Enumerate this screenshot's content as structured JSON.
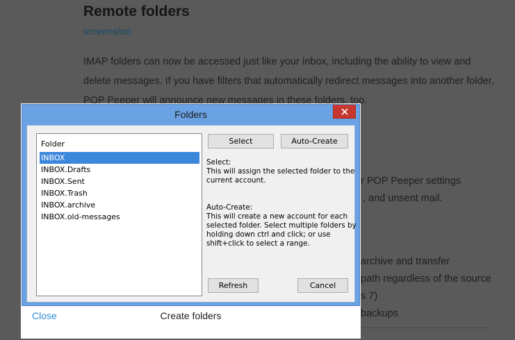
{
  "article": {
    "title": "Remote folders",
    "link": "screenshot",
    "paragraph": "IMAP folders can now be accessed just like your inbox, including the ability to view and delete messages. If you have filters that automatically redirect messages into another folder, POP Peeper will announce new messages in these folders, too.",
    "fragments": [
      "r POP Peeper settings",
      ", and unsent mail.",
      "archive and transfer",
      "path regardless of the source",
      "s 7)",
      "backups"
    ]
  },
  "dialog": {
    "title": "Folders",
    "list_header": "Folder",
    "folders": [
      "INBOX",
      "INBOX.Drafts",
      "INBOX.Sent",
      "INBOX.Trash",
      "INBOX.archive",
      "INBOX.old-messages"
    ],
    "selected_index": 0,
    "buttons": {
      "select": "Select",
      "auto_create": "Auto-Create",
      "refresh": "Refresh",
      "cancel": "Cancel"
    },
    "select_info": {
      "heading": "Select:",
      "lines": [
        "This will assign the selected folder to the",
        "current account."
      ]
    },
    "auto_info": {
      "heading": "Auto-Create:",
      "lines": [
        "This will create a new account for each",
        "selected folder.  Select multiple folders by",
        "holding down ctrl and click; or use",
        "shift+click to select a range."
      ]
    }
  },
  "lightbox": {
    "close_label": "Close",
    "caption": "Create folders"
  },
  "colors": {
    "titlebar": "#6aa2e4",
    "close_button": "#c7372e",
    "selection": "#3b87dc",
    "link": "#2e8fd6"
  },
  "icons": {
    "window_close": "close-icon"
  }
}
